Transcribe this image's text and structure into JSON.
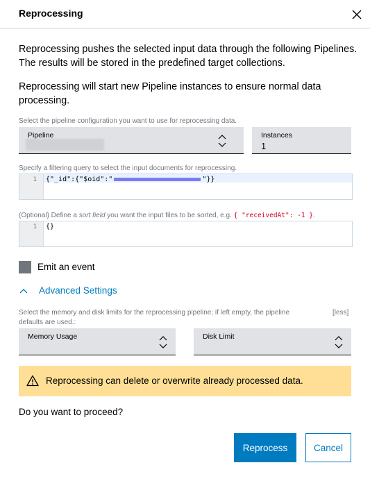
{
  "dialog": {
    "title": "Reprocessing"
  },
  "intro": {
    "paragraph1": "Reprocessing pushes the selected input data through the following Pipelines. The results will be stored in the predefined target collections.",
    "paragraph2": "Reprocessing will start new Pipeline instances to ensure normal data processing."
  },
  "pipeline_section": {
    "hint": "Select the pipeline configuration you want to use for reprocessing data.",
    "pipeline_label": "Pipeline",
    "instances_label": "Instances",
    "instances_value": "1"
  },
  "filter_section": {
    "hint": "Specify a filtering query to select the input documents for reprocessing.",
    "line_number": "1",
    "code_prefix": "{\"_id\":{\"$oid\":\"",
    "code_suffix": "\"}}"
  },
  "sort_section": {
    "hint_prefix": "(Optional) Define a ",
    "hint_em": "sort field",
    "hint_middle": " you want the input files to be sorted, e.g. ",
    "hint_code": "{ \"receivedAt\": -1 }",
    "hint_suffix": ".",
    "line_number": "1",
    "code": "{}"
  },
  "emit_event": {
    "label": "Emit an event"
  },
  "advanced": {
    "toggle_label": "Advanced Settings",
    "hint_line1": "Select the memory and disk limits for the reprocessing pipeline; if left empty, the pipeline",
    "hint_line2": "defaults are used.:",
    "less_link": "[less]",
    "memory_label": "Memory Usage",
    "disk_label": "Disk Limit"
  },
  "warning": {
    "text": "Reprocessing can delete or overwrite already processed data."
  },
  "confirm": {
    "question": "Do you want to proceed?",
    "primary_label": "Reprocess",
    "secondary_label": "Cancel"
  },
  "colors": {
    "accent": "#007bc0",
    "warning_bg": "#ffdf95",
    "field_bg": "#e0e2e5",
    "muted_text": "#71767c"
  },
  "icons": [
    "close-icon",
    "chevron-up-down-icon",
    "chevron-up-icon",
    "warning-icon"
  ]
}
